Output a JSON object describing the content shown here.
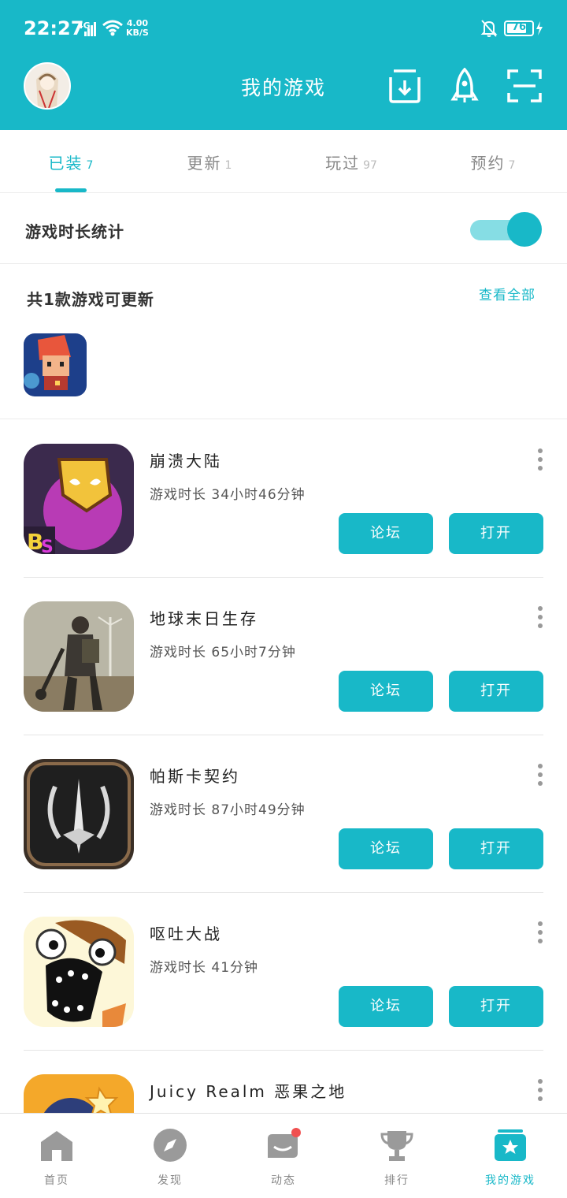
{
  "status_bar": {
    "time": "22:27",
    "network": "4G",
    "speed_value": "4.00",
    "speed_unit": "KB/S",
    "battery": "76"
  },
  "header": {
    "title": "我的游戏"
  },
  "tabs": [
    {
      "label": "已装",
      "count": "7"
    },
    {
      "label": "更新",
      "count": "1"
    },
    {
      "label": "玩过",
      "count": "97"
    },
    {
      "label": "预约",
      "count": "7"
    }
  ],
  "stats": {
    "label": "游戏时长统计",
    "enabled": true
  },
  "updates": {
    "title": "共1款游戏可更新",
    "view_all": "查看全部"
  },
  "buttons": {
    "forum": "论坛",
    "open": "打开"
  },
  "games": [
    {
      "name": "崩溃大陆",
      "playtime": "游戏时长 34小时46分钟"
    },
    {
      "name": "地球末日生存",
      "playtime": "游戏时长 65小时7分钟"
    },
    {
      "name": "帕斯卡契约",
      "playtime": "游戏时长 87小时49分钟"
    },
    {
      "name": "呕吐大战",
      "playtime": "游戏时长 41分钟"
    },
    {
      "name": "Juicy Realm 恶果之地",
      "playtime": ""
    }
  ],
  "bottom_nav": [
    {
      "label": "首页",
      "icon": "home-icon"
    },
    {
      "label": "发现",
      "icon": "compass-icon"
    },
    {
      "label": "动态",
      "icon": "chat-icon"
    },
    {
      "label": "排行",
      "icon": "trophy-icon"
    },
    {
      "label": "我的游戏",
      "icon": "my-games-icon"
    }
  ],
  "colors": {
    "accent": "#18b8c8",
    "accent_light": "#86dde4"
  }
}
